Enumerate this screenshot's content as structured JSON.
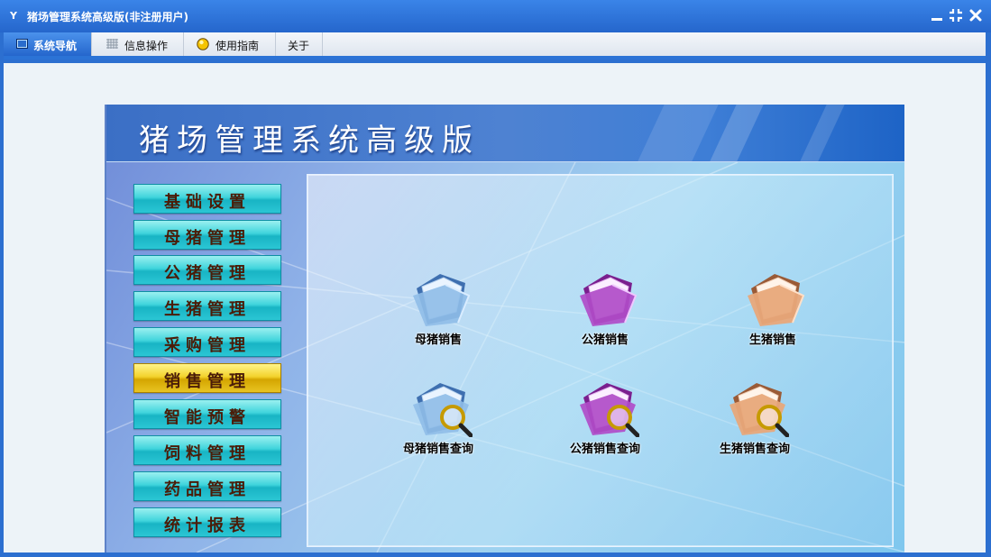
{
  "window": {
    "title": "猪场管理系统高级版(非注册用户)",
    "app_icon": "Y"
  },
  "menu": {
    "tabs": [
      {
        "label": "系统导航",
        "icon": "monitor-icon",
        "active": true
      },
      {
        "label": "信息操作",
        "icon": "grid-icon",
        "active": false
      },
      {
        "label": "使用指南",
        "icon": "help-orb-icon",
        "active": false
      },
      {
        "label": "关于",
        "icon": "",
        "active": false
      }
    ]
  },
  "app": {
    "banner_title": "猪场管理系统高级版",
    "nav": [
      {
        "label": "基础设置",
        "active": false
      },
      {
        "label": "母猪管理",
        "active": false
      },
      {
        "label": "公猪管理",
        "active": false
      },
      {
        "label": "生猪管理",
        "active": false
      },
      {
        "label": "采购管理",
        "active": false
      },
      {
        "label": "销售管理",
        "active": true
      },
      {
        "label": "智能预警",
        "active": false
      },
      {
        "label": "饲料管理",
        "active": false
      },
      {
        "label": "药品管理",
        "active": false
      },
      {
        "label": "统计报表",
        "active": false
      }
    ],
    "tiles": [
      {
        "label": "母猪销售",
        "icon": "blue-folder-icon",
        "color": "#6fa6e0"
      },
      {
        "label": "公猪销售",
        "icon": "purple-folder-icon",
        "color": "#b04cc8"
      },
      {
        "label": "生猪销售",
        "icon": "peach-folder-icon",
        "color": "#e8a87a"
      },
      {
        "label": "母猪销售查询",
        "icon": "blue-folder-search-icon",
        "color": "#6fa6e0"
      },
      {
        "label": "公猪销售查询",
        "icon": "purple-folder-search-icon",
        "color": "#b04cc8"
      },
      {
        "label": "生猪销售查询",
        "icon": "peach-folder-search-icon",
        "color": "#e8a87a"
      }
    ]
  },
  "colors": {
    "accent": "#2c6fd0",
    "nav_active": "#f3d22c",
    "nav_normal": "#2bc6d4",
    "nav_text": "#4a1c08"
  }
}
